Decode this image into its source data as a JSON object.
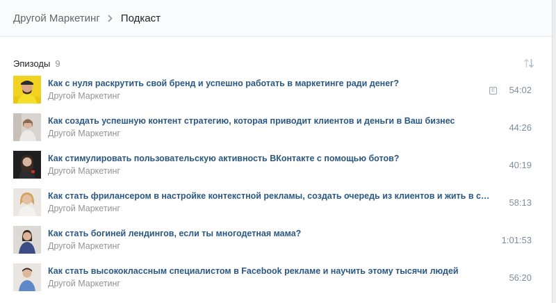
{
  "breadcrumb": {
    "parent": "Другой Маркетинг",
    "current": "Подкаст"
  },
  "episodes_header": {
    "title": "Эпизоды",
    "count": "9"
  },
  "episodes": [
    {
      "title": "Как с нуля раскрутить свой бренд и успешно работать в маркетинге ради денег?",
      "author": "Другой Маркетинг",
      "duration": "54:02",
      "explicit": "E"
    },
    {
      "title": "Как создать успешную контент стратегию, которая приводит клиентов и деньги в Ваш бизнес",
      "author": "Другой Маркетинг",
      "duration": "44:26"
    },
    {
      "title": "Как стимулировать пользовательскую активность ВКонтакте с помощью ботов?",
      "author": "Другой Маркетинг",
      "duration": "40:19"
    },
    {
      "title": "Как стать фрилансером в настройке контекстной рекламы, создать очередь из клиентов и жить в св...",
      "author": "Другой Маркетинг",
      "duration": "58:13"
    },
    {
      "title": "Как стать богиней лендингов, если ты многодетная мама?",
      "author": "Другой Маркетинг",
      "duration": "1:01:53"
    },
    {
      "title": "Как стать высококлассным специалистом в Facebook рекламе и научить этому тысячи людей",
      "author": "Другой Маркетинг",
      "duration": "56:20"
    }
  ],
  "colors": {
    "link": "#2a5885",
    "muted": "#939393",
    "background": "#edeef0"
  }
}
